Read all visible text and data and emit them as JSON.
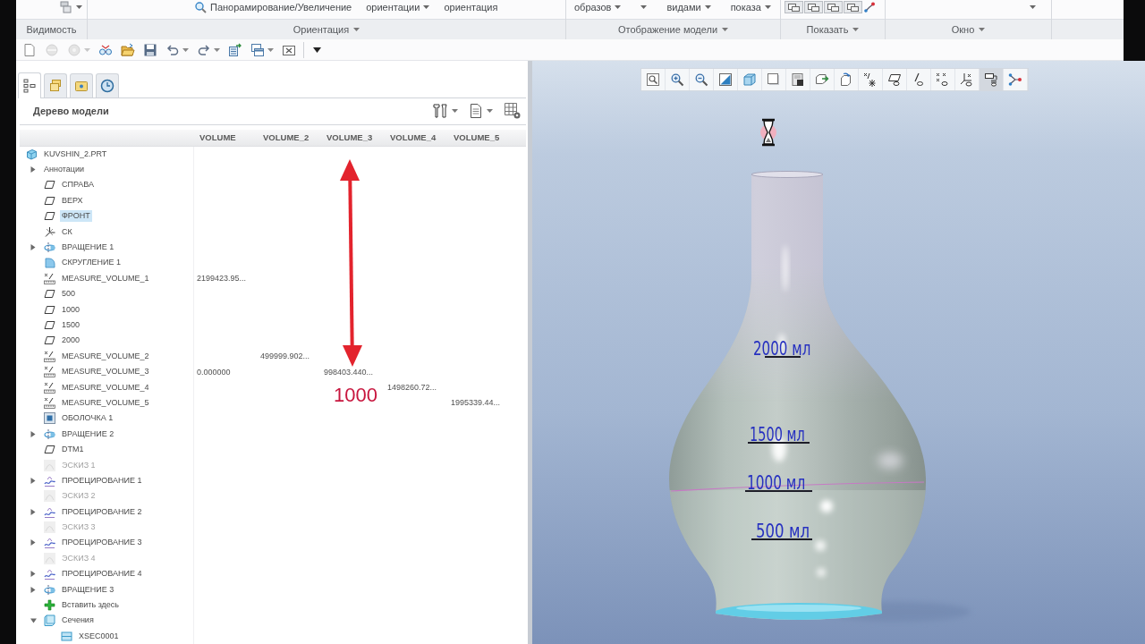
{
  "ribbon": {
    "groups": [
      {
        "label": "Видимость",
        "menu": false,
        "items": [
          {
            "kind": "layers",
            "dropdown": true
          }
        ]
      },
      {
        "label": "Ориентация",
        "menu": true,
        "items": [
          {
            "kind": "pan",
            "label": "Панорамирование/Увеличение",
            "dropdown": false
          },
          {
            "kind": "text",
            "label": "ориентации",
            "dropdown": true
          },
          {
            "kind": "text",
            "label": "ориентация",
            "dropdown": false
          }
        ]
      },
      {
        "label": "Отображение модели",
        "menu": true,
        "items": [
          {
            "kind": "text",
            "label": "образов",
            "dropdown": true
          },
          {
            "kind": "caret"
          },
          {
            "kind": "text",
            "label": "видами",
            "dropdown": true
          },
          {
            "kind": "text",
            "label": "показа",
            "dropdown": true
          }
        ]
      },
      {
        "label": "Показать",
        "menu": true,
        "items": [
          {
            "kind": "tile"
          },
          {
            "kind": "tile"
          },
          {
            "kind": "tile"
          },
          {
            "kind": "tile"
          },
          {
            "kind": "branch"
          }
        ]
      },
      {
        "label": "Окно",
        "menu": true,
        "items": [
          {
            "kind": "caret"
          }
        ]
      }
    ]
  },
  "quick_access_toolbar": [
    {
      "kind": "new",
      "disabled": false
    },
    {
      "kind": "disc",
      "disabled": true
    },
    {
      "kind": "disc_menu",
      "disabled": true
    },
    {
      "kind": "regenerate",
      "disabled": false
    },
    {
      "kind": "open",
      "disabled": false
    },
    {
      "kind": "save",
      "disabled": false
    },
    {
      "kind": "undo",
      "disabled": false
    },
    {
      "kind": "redo",
      "disabled": false
    },
    {
      "kind": "regen_manager",
      "disabled": false
    },
    {
      "kind": "windows",
      "disabled": false
    },
    {
      "kind": "close",
      "disabled": false
    },
    {
      "kind": "customize",
      "disabled": false
    }
  ],
  "model_tree": {
    "tabs": [
      {
        "kind": "tree",
        "selected": true
      },
      {
        "kind": "layers",
        "selected": false
      },
      {
        "kind": "folder",
        "selected": false
      },
      {
        "kind": "history",
        "selected": false
      }
    ],
    "title": "Дерево модели",
    "columns": [
      "VOLUME",
      "VOLUME_2",
      "VOLUME_3",
      "VOLUME_4",
      "VOLUME_5"
    ],
    "root": {
      "label": "KUVSHIN_2.PRT",
      "kind": "part",
      "selected": false,
      "dimmed": false,
      "children": [
        {
          "label": "Аннотации",
          "kind": "group",
          "expanded": false,
          "selected": false,
          "dimmed": false
        },
        {
          "label": "СПРАВА",
          "kind": "plane",
          "selected": false,
          "dimmed": false
        },
        {
          "label": "ВЕРХ",
          "kind": "plane",
          "selected": false,
          "dimmed": false
        },
        {
          "label": "ФРОНТ",
          "kind": "plane",
          "selected": true,
          "dimmed": false
        },
        {
          "label": "СК",
          "kind": "csys",
          "selected": false,
          "dimmed": false
        },
        {
          "label": "ВРАЩЕНИЕ 1",
          "kind": "revolve",
          "expanded": false,
          "selected": false,
          "dimmed": false
        },
        {
          "label": "СКРУГЛЕНИЕ 1",
          "kind": "round",
          "selected": false,
          "dimmed": false
        },
        {
          "label": "MEASURE_VOLUME_1",
          "kind": "measure",
          "selected": false,
          "dimmed": false,
          "cells": [
            "2199423.95...",
            null,
            null,
            null,
            null
          ]
        },
        {
          "label": "500",
          "kind": "plane",
          "selected": false,
          "dimmed": false
        },
        {
          "label": "1000",
          "kind": "plane",
          "selected": false,
          "dimmed": false
        },
        {
          "label": "1500",
          "kind": "plane",
          "selected": false,
          "dimmed": false
        },
        {
          "label": "2000",
          "kind": "plane",
          "selected": false,
          "dimmed": false
        },
        {
          "label": "MEASURE_VOLUME_2",
          "kind": "measure",
          "selected": false,
          "dimmed": false,
          "cells": [
            null,
            "499999.902...",
            null,
            null,
            null
          ]
        },
        {
          "label": "MEASURE_VOLUME_3",
          "kind": "measure",
          "selected": false,
          "dimmed": false,
          "cells": [
            "0.000000",
            null,
            "998403.440...",
            null,
            null
          ]
        },
        {
          "label": "MEASURE_VOLUME_4",
          "kind": "measure",
          "selected": false,
          "dimmed": false,
          "cells": [
            null,
            null,
            null,
            "1498260.72...",
            null
          ]
        },
        {
          "label": "MEASURE_VOLUME_5",
          "kind": "measure",
          "selected": false,
          "dimmed": false,
          "cells": [
            null,
            null,
            null,
            null,
            "1995339.44..."
          ]
        },
        {
          "label": "ОБОЛОЧКА 1",
          "kind": "shell",
          "selected": false,
          "dimmed": false
        },
        {
          "label": "ВРАЩЕНИЕ 2",
          "kind": "revolve",
          "expanded": false,
          "selected": false,
          "dimmed": false
        },
        {
          "label": "DTM1",
          "kind": "plane",
          "selected": false,
          "dimmed": false
        },
        {
          "label": "ЭСКИЗ 1",
          "kind": "sketch",
          "selected": false,
          "dimmed": true
        },
        {
          "label": "ПРОЕЦИРОВАНИЕ 1",
          "kind": "project",
          "expanded": false,
          "selected": false,
          "dimmed": false
        },
        {
          "label": "ЭСКИЗ 2",
          "kind": "sketch",
          "selected": false,
          "dimmed": true
        },
        {
          "label": "ПРОЕЦИРОВАНИЕ 2",
          "kind": "project",
          "expanded": false,
          "selected": false,
          "dimmed": false
        },
        {
          "label": "ЭСКИЗ 3",
          "kind": "sketch",
          "selected": false,
          "dimmed": true
        },
        {
          "label": "ПРОЕЦИРОВАНИЕ 3",
          "kind": "project",
          "expanded": false,
          "selected": false,
          "dimmed": false
        },
        {
          "label": "ЭСКИЗ 4",
          "kind": "sketch",
          "selected": false,
          "dimmed": true
        },
        {
          "label": "ПРОЕЦИРОВАНИЕ 4",
          "kind": "project",
          "expanded": false,
          "selected": false,
          "dimmed": false
        },
        {
          "label": "ВРАЩЕНИЕ 3",
          "kind": "revolve",
          "expanded": false,
          "selected": false,
          "dimmed": false
        },
        {
          "label": "Вставить здесь",
          "kind": "insert",
          "selected": false,
          "dimmed": false
        },
        {
          "label": "Сечения",
          "kind": "sections",
          "expanded": true,
          "selected": false,
          "dimmed": false,
          "children": [
            {
              "label": "XSEC0001",
              "kind": "xsec",
              "selected": false,
              "dimmed": false
            }
          ]
        }
      ]
    }
  },
  "annotation": {
    "label": "1000"
  },
  "viewport": {
    "toolbar": [
      {
        "kind": "fit",
        "on": false
      },
      {
        "kind": "zoomin",
        "on": false
      },
      {
        "kind": "zoomout",
        "on": false
      },
      {
        "kind": "repaint",
        "on": false
      },
      {
        "kind": "style",
        "on": false
      },
      {
        "kind": "orient",
        "on": false
      },
      {
        "kind": "views",
        "on": false
      },
      {
        "kind": "perspective",
        "on": false
      },
      {
        "kind": "spin",
        "on": false
      },
      {
        "kind": "datums",
        "on": false
      },
      {
        "kind": "planes",
        "on": false
      },
      {
        "kind": "axes",
        "on": false
      },
      {
        "kind": "points",
        "on": false
      },
      {
        "kind": "csys",
        "on": false
      },
      {
        "kind": "annotations",
        "on": true
      },
      {
        "kind": "branch",
        "on": false
      }
    ],
    "marks": [
      {
        "label": "2000 мл"
      },
      {
        "label": "1500 мл"
      },
      {
        "label": "1000 мл"
      },
      {
        "label": "500 мл"
      }
    ]
  }
}
